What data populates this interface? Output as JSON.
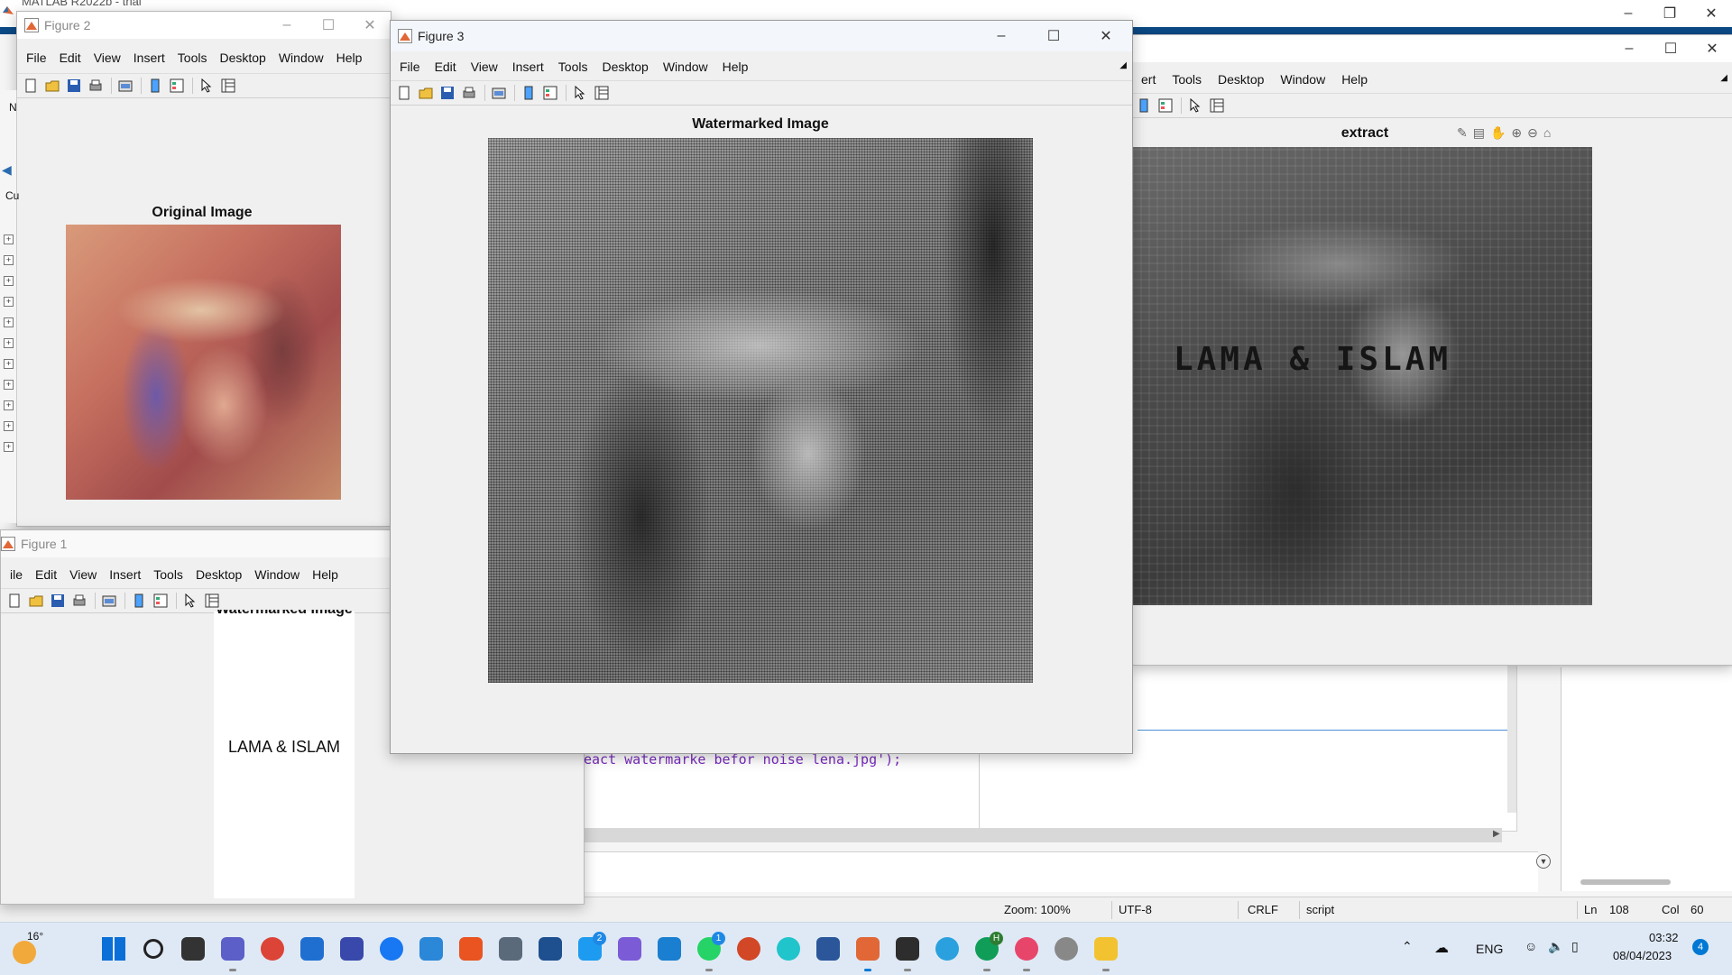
{
  "matlab_main": {
    "title": "MATLAB R2022b - trial"
  },
  "figure2": {
    "title": "Figure 2",
    "menus": [
      "File",
      "Edit",
      "View",
      "Insert",
      "Tools",
      "Desktop",
      "Window",
      "Help"
    ],
    "axes_title": "Original Image",
    "side_letters": [
      "N",
      "Cu"
    ]
  },
  "figure3": {
    "title": "Figure 3",
    "menus": [
      "File",
      "Edit",
      "View",
      "Insert",
      "Tools",
      "Desktop",
      "Window",
      "Help"
    ],
    "axes_title": "Watermarked Image"
  },
  "figure_right": {
    "menus": [
      "ert",
      "Tools",
      "Desktop",
      "Window",
      "Help"
    ],
    "axes_title": "extract",
    "watermark_text": "LAMA & ISLAM"
  },
  "figure1": {
    "title": "Figure 1",
    "menus": [
      "ile",
      "Edit",
      "View",
      "Insert",
      "Tools",
      "Desktop",
      "Window",
      "Help"
    ],
    "axes_title_partial": "Watermarked Image",
    "watermark_text": "LAMA & ISLAM"
  },
  "editor": {
    "code_line": "eact watermarke befor noise lena.jpg');"
  },
  "statusbar": {
    "zoom": "Zoom: 100%",
    "encoding": "UTF-8",
    "line_ending": "CRLF",
    "file_type": "script",
    "ln_label": "Ln",
    "ln_value": "108",
    "col_label": "Col",
    "col_value": "60"
  },
  "taskbar": {
    "weather_temp": "16°",
    "language": "ENG",
    "time": "03:32",
    "date": "08/04/2023",
    "notification_count": "4",
    "twitter_badge": "2",
    "whatsapp_badge": "1",
    "chrome_profile_badge": "H",
    "apps": [
      "start",
      "search",
      "task-view",
      "teams",
      "chrome",
      "store",
      "matlab-web",
      "facebook",
      "photos",
      "ubuntu",
      "cube",
      "devcpp",
      "twitter",
      "visual-studio",
      "vscode",
      "whatsapp",
      "powerpoint",
      "canva",
      "word",
      "matlab",
      "terminal",
      "telegram",
      "chrome-profile",
      "game",
      "bubbles",
      "file-explorer"
    ]
  },
  "colors": {
    "accent": "#0078d4",
    "matlab_orange": "#e16737",
    "window_bg": "#f0f0f0",
    "taskbar_bg": "#dfe9f5"
  }
}
